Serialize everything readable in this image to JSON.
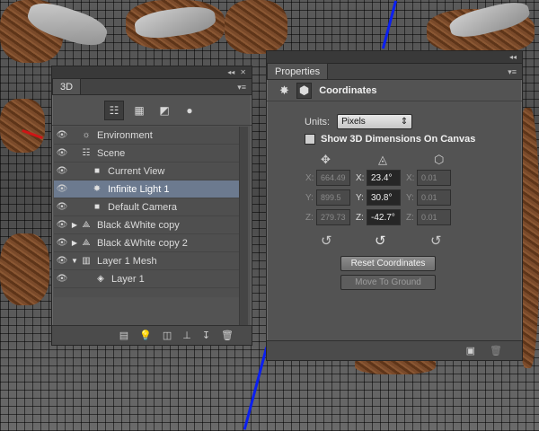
{
  "panel_3d": {
    "tab": "3D",
    "collapse_glyph": "◂◂",
    "close_glyph": "✕",
    "menu_glyph": "▾≡",
    "filter_icons": [
      "whole-scene-icon",
      "meshes-icon",
      "materials-icon",
      "lights-icon"
    ],
    "rows": [
      {
        "label": "Environment",
        "icon": "environment-icon"
      },
      {
        "label": "Scene",
        "icon": "scene-icon"
      },
      {
        "label": "Current View",
        "icon": "camera-icon"
      },
      {
        "label": "Infinite Light 1",
        "icon": "light-icon",
        "selected": true
      },
      {
        "label": "Default Camera",
        "icon": "camera-icon"
      },
      {
        "label": "Black &White copy",
        "icon": "mesh-icon",
        "collapsed": true
      },
      {
        "label": "Black &White copy 2",
        "icon": "mesh-icon",
        "collapsed": true
      },
      {
        "label": "Layer 1 Mesh",
        "icon": "mesh-icon",
        "expanded": true
      },
      {
        "label": "Layer 1",
        "icon": "material-icon"
      }
    ],
    "bottom_icons": [
      "render-icon",
      "add-light-icon",
      "add-material-icon",
      "drop-to-ground-icon",
      "new-object-icon",
      "delete-icon"
    ]
  },
  "panel_props": {
    "tab": "Properties",
    "section_title": "Coordinates",
    "units_label": "Units:",
    "units_value": "Pixels",
    "show_dimensions_label": "Show 3D Dimensions On Canvas",
    "position": {
      "x": "664.49",
      "y": "899.5",
      "z": "279.73"
    },
    "rotation": {
      "x": "23.4°",
      "y": "30.8°",
      "z": "-42.7°"
    },
    "scale": {
      "x": "0.01",
      "y": "0.01",
      "z": "0.01"
    },
    "axis_labels": {
      "x": "X:",
      "y": "Y:",
      "z": "Z:"
    },
    "reset_coordinates": "Reset Coordinates",
    "move_to_ground": "Move To Ground"
  },
  "colors": {
    "panel_bg": "#535353",
    "selection": "#6c7a8f",
    "axis_blue": "#0b1ff0",
    "axis_red": "#d01515"
  }
}
